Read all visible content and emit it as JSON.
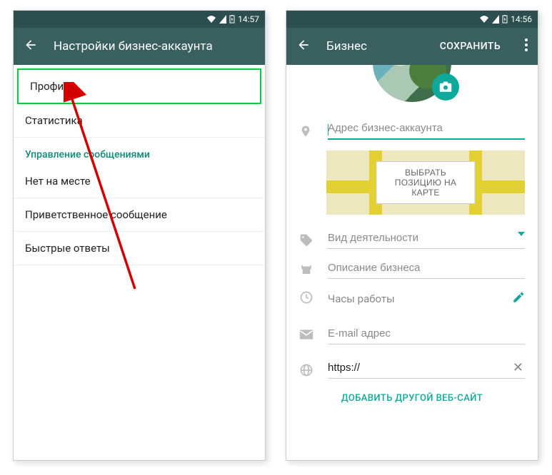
{
  "statusbar": {
    "time_left": "14:57",
    "time_right": "14:56"
  },
  "left": {
    "title": "Настройки бизнес-аккаунта",
    "items": {
      "profile": "Профиль",
      "stats": "Статистика",
      "section": "Управление сообщениями",
      "away": "Нет на месте",
      "greeting": "Приветственное сообщение",
      "quick": "Быстрые ответы"
    }
  },
  "right": {
    "title": "Бизнес",
    "save": "СОХРАНИТЬ",
    "fields": {
      "address_ph": "Адрес бизнес-аккаунта",
      "map_btn": "ВЫБРАТЬ ПОЗИЦИЮ НА КАРТЕ",
      "category_ph": "Вид деятельности",
      "desc_ph": "Описание бизнеса",
      "hours": "Часы работы",
      "email_ph": "E-mail адрес",
      "website_val": "https://",
      "add_site": "ДОБАВИТЬ ДРУГОЙ ВЕБ-САЙТ"
    }
  }
}
